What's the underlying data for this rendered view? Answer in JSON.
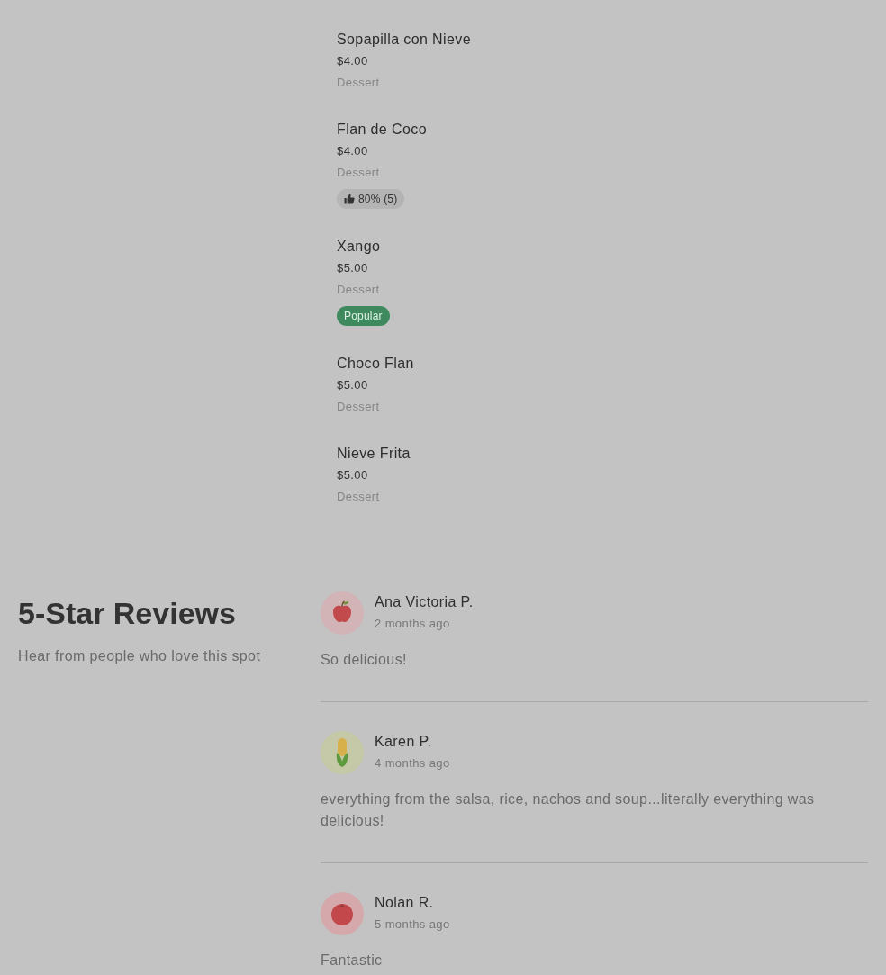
{
  "menu_items": [
    {
      "name": "Sopapilla con Nieve",
      "price": "$4.00",
      "category": "Dessert"
    },
    {
      "name": "Flan de Coco",
      "price": "$4.00",
      "category": "Dessert",
      "badge": {
        "kind": "rating",
        "text": "80% (5)"
      }
    },
    {
      "name": "Xango",
      "price": "$5.00",
      "category": "Dessert",
      "badge": {
        "kind": "popular",
        "text": "Popular"
      }
    },
    {
      "name": "Choco Flan",
      "price": "$5.00",
      "category": "Dessert"
    },
    {
      "name": "Nieve Frita",
      "price": "$5.00",
      "category": "Dessert"
    }
  ],
  "reviews_section": {
    "title": "5-Star Reviews",
    "subtitle": "Hear from people who love this spot",
    "reviews": [
      {
        "kind": "apple",
        "name": "Ana Victoria P.",
        "date": "2 months ago",
        "text": "So delicious!"
      },
      {
        "kind": "corn",
        "name": "Karen P.",
        "date": "4 months ago",
        "text": "everything from the salsa, rice, nachos and soup...literally everything was delicious!"
      },
      {
        "kind": "tomato",
        "name": "Nolan R.",
        "date": "5 months ago",
        "text": "Fantastic"
      }
    ]
  }
}
